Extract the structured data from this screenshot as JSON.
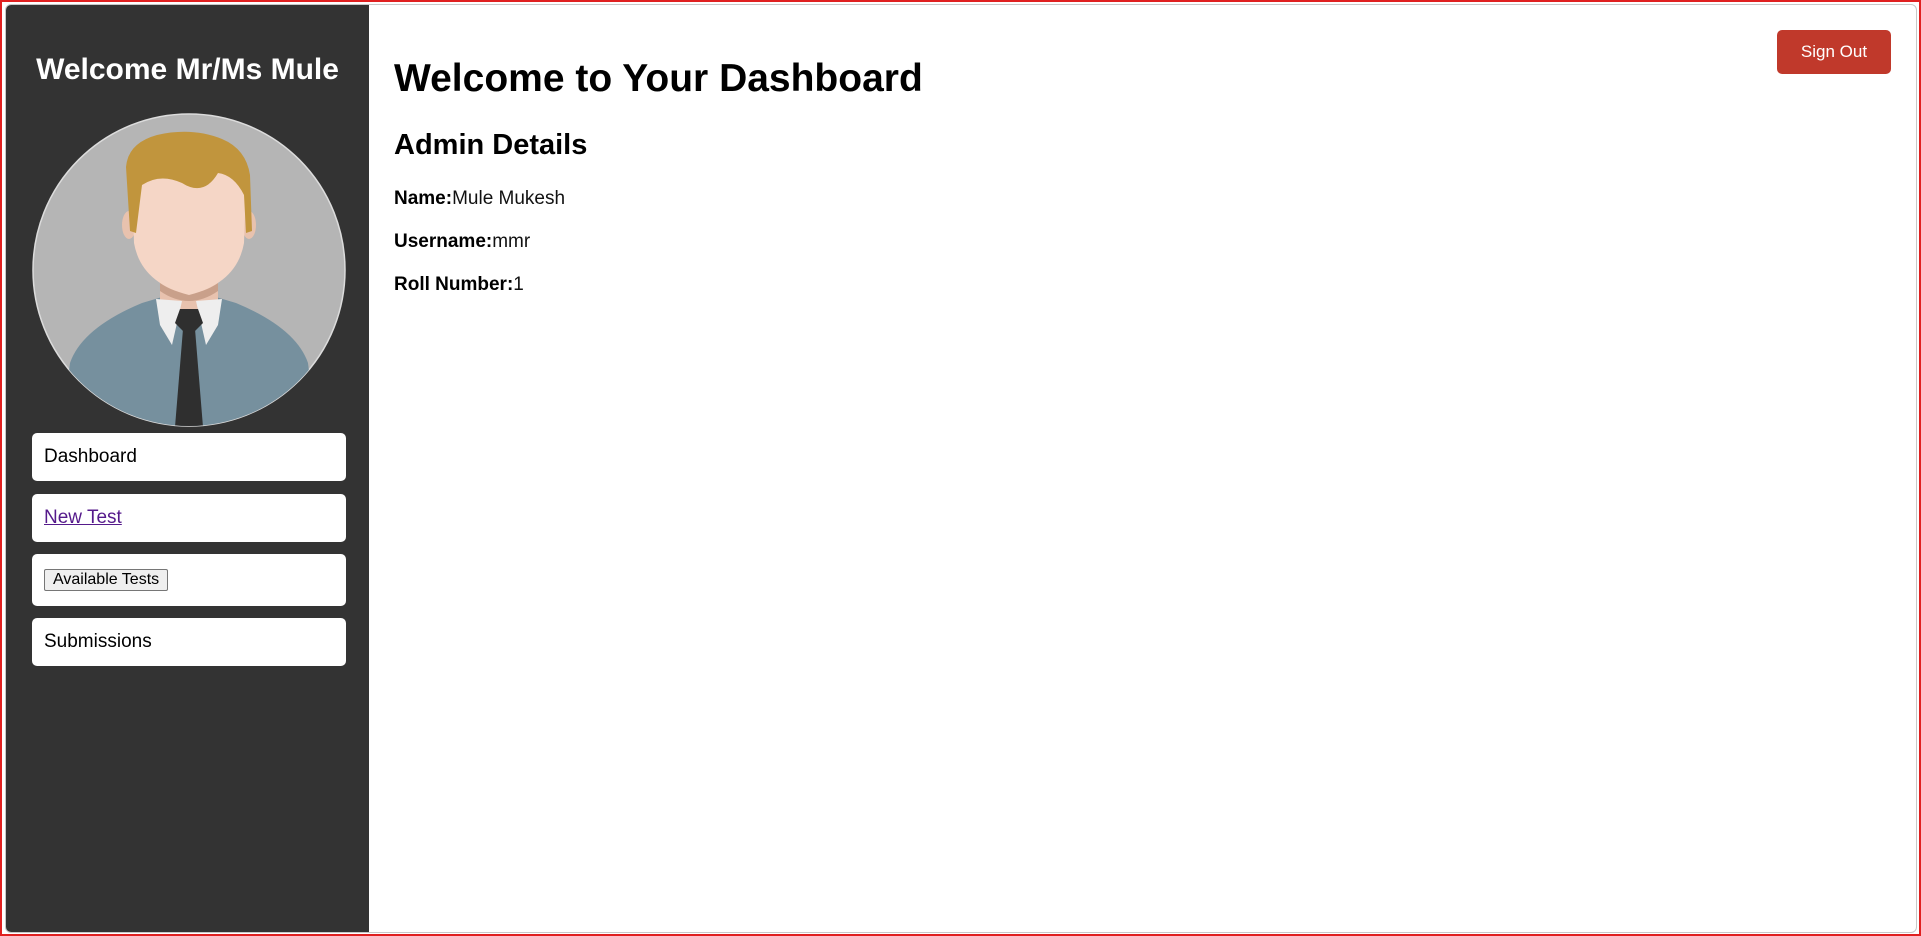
{
  "sidebar": {
    "welcome": "Welcome Mr/Ms Mule",
    "avatar_icon": "user-avatar-icon",
    "nav": {
      "dashboard": "Dashboard",
      "new_test": "New Test",
      "available_tests": "Available Tests",
      "submissions": "Submissions"
    }
  },
  "main": {
    "title": "Welcome to Your Dashboard",
    "section_title": "Admin Details",
    "details": [
      {
        "label": "Name:",
        "value": "Mule Mukesh"
      },
      {
        "label": "Username:",
        "value": "mmr"
      },
      {
        "label": "Roll Number:",
        "value": "1"
      }
    ]
  },
  "header": {
    "signout_label": "Sign Out"
  },
  "colors": {
    "sidebar_bg": "#333333",
    "signout_bg": "#c0392b",
    "frame_border": "#e02020"
  }
}
